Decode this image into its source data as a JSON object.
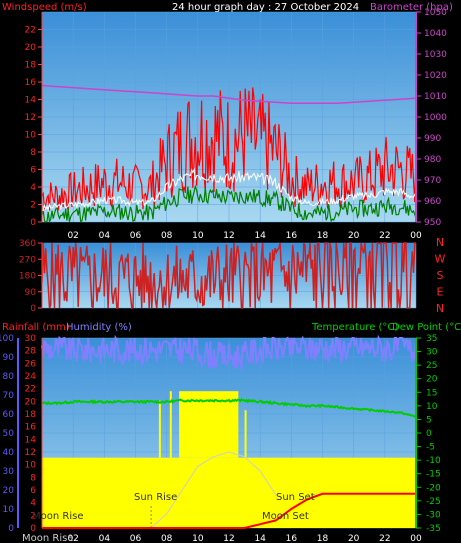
{
  "title": "24 hour graph day : 27 October 2024",
  "colors": {
    "wind": "#ff2020",
    "gust": "#ff0000",
    "avgwind": "#ffffff",
    "wind_low": "#008000",
    "baro": "#cc44cc",
    "dir": "#cc2222",
    "rain": "#ff0000",
    "humidity": "#8080ff",
    "temp": "#00cc00",
    "dew": "#00cc00",
    "sun": "#ffff00",
    "bg_top": "#3a8fd8",
    "bg_bottom": "#a8d8f0",
    "axis_left": "#5a5aff",
    "axis_right": "#cc44cc",
    "axis_right_temp": "#00cc00"
  },
  "chart_data": [
    {
      "type": "line",
      "panel": "wind",
      "title": "Windspeed (m/s)",
      "ylabel_right": "Barometer (hpa)",
      "x_ticks": [
        "02",
        "04",
        "06",
        "08",
        "10",
        "12",
        "14",
        "16",
        "18",
        "20",
        "22",
        "00"
      ],
      "x_hours": [
        0,
        1,
        2,
        3,
        4,
        5,
        6,
        7,
        8,
        9,
        10,
        11,
        12,
        13,
        14,
        15,
        16,
        17,
        18,
        19,
        20,
        21,
        22,
        23,
        24
      ],
      "ylim": [
        0,
        24
      ],
      "y_ticks": [
        0,
        2,
        4,
        6,
        8,
        10,
        12,
        14,
        16,
        18,
        20,
        22
      ],
      "y2lim": [
        950,
        1050
      ],
      "y2_ticks": [
        950,
        960,
        970,
        980,
        990,
        1000,
        1010,
        1020,
        1030,
        1040,
        1050
      ],
      "series": [
        {
          "name": "gust",
          "values": [
            3,
            3,
            3.5,
            4,
            4.5,
            4.5,
            4,
            4,
            7,
            9,
            10,
            10,
            9,
            10,
            9,
            8,
            5,
            4,
            4.5,
            4.5,
            4.5,
            5,
            6,
            6,
            5
          ]
        },
        {
          "name": "avg",
          "values": [
            1.5,
            1.8,
            2,
            2.2,
            2.5,
            2.5,
            2.2,
            2.3,
            4,
            5,
            5.5,
            5.3,
            5,
            5.2,
            5,
            4.5,
            2.8,
            2.2,
            2.3,
            2.5,
            3,
            3,
            3.5,
            3.5,
            2.8
          ]
        },
        {
          "name": "low",
          "values": [
            0.5,
            0.8,
            1,
            1,
            1.2,
            1.2,
            1,
            1,
            2.2,
            3,
            3.2,
            3,
            2.8,
            3,
            2.8,
            2.5,
            1.5,
            1,
            1,
            1.2,
            1.5,
            1.5,
            1.8,
            1.8,
            1.2
          ]
        },
        {
          "name": "baro",
          "values": [
            1015,
            1014.5,
            1014,
            1013.5,
            1013,
            1012.5,
            1012,
            1011.5,
            1011,
            1010.5,
            1010,
            1010,
            1009,
            1008,
            1007.5,
            1007,
            1006.5,
            1006.5,
            1006.5,
            1006.5,
            1007,
            1007.5,
            1008,
            1008.5,
            1009
          ]
        }
      ]
    },
    {
      "type": "line",
      "panel": "direction",
      "ylim": [
        0,
        360
      ],
      "y_ticks": [
        0,
        90,
        180,
        270,
        360
      ],
      "right_labels": [
        "N",
        "W",
        "S",
        "E",
        "N"
      ],
      "series": [
        {
          "name": "direction",
          "values": [
            180,
            180,
            165,
            160,
            170,
            165,
            160,
            160,
            150,
            155,
            158,
            160,
            165,
            170,
            175,
            180,
            190,
            200,
            210,
            225,
            235,
            240,
            245,
            250,
            245
          ]
        }
      ]
    },
    {
      "type": "line",
      "panel": "temp",
      "title_left_1": "Rainfall (mm)",
      "title_left_2": "Humidity (%)",
      "title_right_1": "Temperature (°C)",
      "title_right_2": "Dew Point (°C)",
      "ylim": [
        0,
        100
      ],
      "y_ticks": [
        0,
        10,
        20,
        30,
        40,
        50,
        60,
        70,
        80,
        90,
        100
      ],
      "y_ticks_inner": [
        0,
        2,
        4,
        6,
        8,
        10,
        12,
        14,
        16,
        18,
        20,
        22,
        24,
        26,
        28,
        30
      ],
      "y2lim": [
        -35,
        35
      ],
      "y2_ticks": [
        -35,
        -30,
        -25,
        -20,
        -15,
        -10,
        -5,
        0,
        5,
        10,
        15,
        20,
        25,
        30,
        35
      ],
      "sun_rise_label": "Sun Rise",
      "sun_set_label": "Sun Set",
      "moon_rise_label": "Moon Rise",
      "moon_set_label": "Moon Set",
      "bottom_left_label": "Moon Rise",
      "series": [
        {
          "name": "humidity",
          "values": [
            95,
            94,
            94,
            94,
            94,
            94,
            94,
            94,
            94,
            94,
            93,
            91,
            90,
            91,
            94,
            95,
            95,
            95,
            95,
            95,
            95,
            95,
            95,
            95,
            93
          ]
        },
        {
          "name": "temperature",
          "values": [
            11,
            11,
            11.5,
            11.5,
            11.5,
            11.5,
            11.5,
            11.5,
            11.5,
            12,
            12,
            12,
            12,
            12,
            11.5,
            11,
            10.5,
            10,
            10,
            9.5,
            9,
            8.5,
            8,
            7.5,
            6
          ]
        },
        {
          "name": "rain",
          "values": [
            0,
            0,
            0,
            0,
            0,
            0,
            0,
            0,
            0,
            0,
            0,
            0,
            0,
            0,
            0.2,
            0.4,
            1,
            1.5,
            1.8,
            1.8,
            1.8,
            1.8,
            1.8,
            1.8,
            1.8
          ]
        },
        {
          "name": "sun_elevation",
          "values": [
            null,
            null,
            null,
            null,
            null,
            null,
            null,
            0,
            3,
            8,
            13,
            15,
            16,
            15,
            12,
            7,
            0,
            null,
            null,
            null,
            null,
            null,
            null,
            null,
            null
          ]
        }
      ]
    }
  ]
}
